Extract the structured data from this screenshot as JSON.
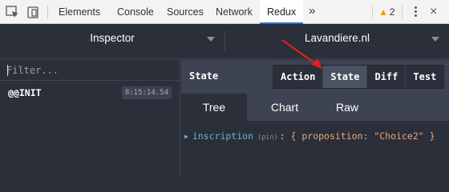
{
  "devtools": {
    "tabs": [
      {
        "label": "Elements"
      },
      {
        "label": "Console"
      },
      {
        "label": "Sources"
      },
      {
        "label": "Network"
      },
      {
        "label": "Redux"
      }
    ],
    "more": "»",
    "warnings": "2",
    "close": "×"
  },
  "redux": {
    "monitor": "Inspector",
    "instance": "Lavandiere.nl",
    "filter_placeholder": "Filter...",
    "actions": [
      {
        "name": "@@INIT",
        "time": "8:15:14.54"
      }
    ],
    "state_label": "State",
    "mode_buttons": [
      {
        "label": "Action"
      },
      {
        "label": "State"
      },
      {
        "label": "Diff"
      },
      {
        "label": "Test"
      }
    ],
    "active_mode": "State",
    "view_tabs": [
      {
        "label": "Tree"
      },
      {
        "label": "Chart"
      },
      {
        "label": "Raw"
      }
    ],
    "active_view": "Tree",
    "tree": {
      "key": "inscription",
      "type": "(pin)",
      "colon": ":",
      "open": "{",
      "prop_key": "proposition:",
      "prop_value": "\"Choice2\"",
      "close": "}"
    }
  },
  "colors": {
    "accent": "#1a73e8",
    "panel_bg": "#2a2f3a",
    "bar_bg": "#3d4350",
    "tree_key": "#6fb3d2",
    "tree_value": "#e8a87c",
    "arrow": "#e02020"
  }
}
